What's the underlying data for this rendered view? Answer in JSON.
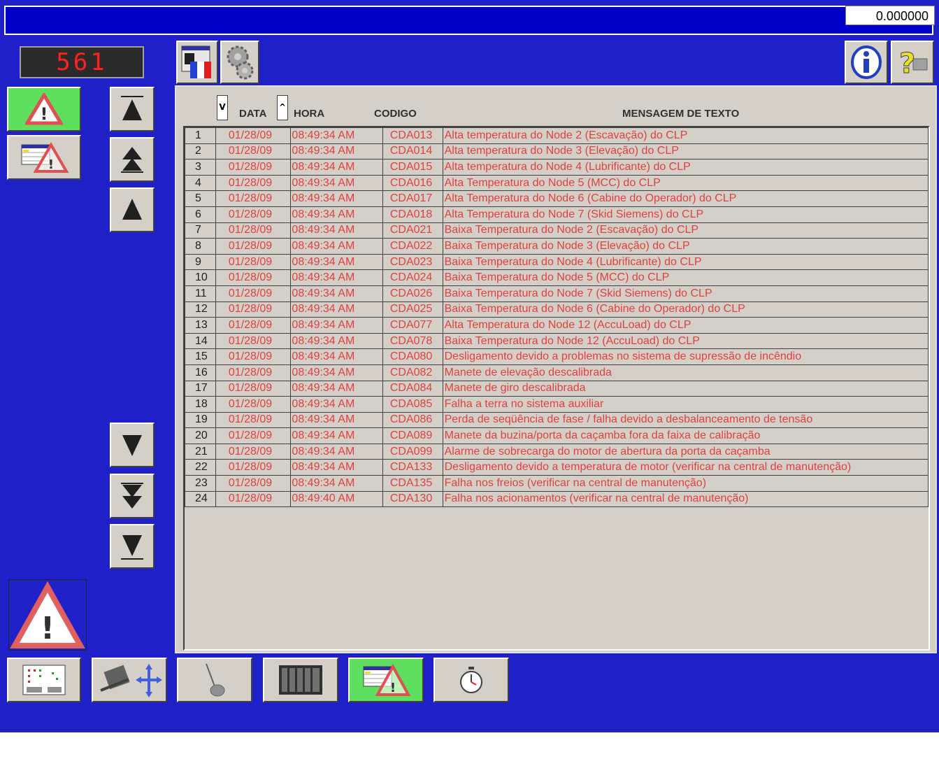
{
  "header": {
    "value_display": "0.000000"
  },
  "counter": {
    "value": "561"
  },
  "colors": {
    "background": "#2020c8",
    "accent_green": "#5ee05e",
    "alarm_text": "#e04040"
  },
  "toolbar_top": [
    {
      "icon": "language-flag-icon"
    },
    {
      "icon": "gears-icon"
    },
    {
      "icon": "info-icon"
    },
    {
      "icon": "help-icon"
    }
  ],
  "table": {
    "columns": {
      "sort_date": "V",
      "date": "DATA",
      "sort_time": "^",
      "time": "HORA",
      "code": "CODIGO",
      "message": "MENSAGEM DE TEXTO"
    },
    "rows": [
      {
        "n": "1",
        "date": "01/28/09",
        "time": "08:49:34 AM",
        "code": "CDA013",
        "msg": "Alta temperatura do Node 2 (Escavação) do CLP"
      },
      {
        "n": "2",
        "date": "01/28/09",
        "time": "08:49:34 AM",
        "code": "CDA014",
        "msg": "Alta temperatura do Node 3 (Elevação) do CLP"
      },
      {
        "n": "3",
        "date": "01/28/09",
        "time": "08:49:34 AM",
        "code": "CDA015",
        "msg": "Alta temperatura do Node 4 (Lubrificante) do CLP"
      },
      {
        "n": "4",
        "date": "01/28/09",
        "time": "08:49:34 AM",
        "code": "CDA016",
        "msg": "Alta Temperatura do Node 5 (MCC) do CLP"
      },
      {
        "n": "5",
        "date": "01/28/09",
        "time": "08:49:34 AM",
        "code": "CDA017",
        "msg": "Alta Temperatura do Node 6 (Cabine do Operador) do CLP"
      },
      {
        "n": "6",
        "date": "01/28/09",
        "time": "08:49:34 AM",
        "code": "CDA018",
        "msg": "Alta Temperatura do Node 7 (Skid Siemens) do CLP"
      },
      {
        "n": "7",
        "date": "01/28/09",
        "time": "08:49:34 AM",
        "code": "CDA021",
        "msg": "Baixa Temperatura do Node 2 (Escavação) do CLP"
      },
      {
        "n": "8",
        "date": "01/28/09",
        "time": "08:49:34 AM",
        "code": "CDA022",
        "msg": "Baixa Temperatura do Node 3 (Elevação) do CLP"
      },
      {
        "n": "9",
        "date": "01/28/09",
        "time": "08:49:34 AM",
        "code": "CDA023",
        "msg": "Baixa Temperatura do Node 4 (Lubrificante) do CLP"
      },
      {
        "n": "10",
        "date": "01/28/09",
        "time": "08:49:34 AM",
        "code": "CDA024",
        "msg": "Baixa Temperatura do Node 5 (MCC) do CLP"
      },
      {
        "n": "11",
        "date": "01/28/09",
        "time": "08:49:34 AM",
        "code": "CDA026",
        "msg": "Baixa Temperatura do Node 7 (Skid Siemens) do CLP"
      },
      {
        "n": "12",
        "date": "01/28/09",
        "time": "08:49:34 AM",
        "code": "CDA025",
        "msg": "Baixa Temperatura do Node 6 (Cabine do Operador) do CLP"
      },
      {
        "n": "13",
        "date": "01/28/09",
        "time": "08:49:34 AM",
        "code": "CDA077",
        "msg": "Alta Temperatura do Node 12 (AccuLoad) do CLP"
      },
      {
        "n": "14",
        "date": "01/28/09",
        "time": "08:49:34 AM",
        "code": "CDA078",
        "msg": "Baixa Temperatura do Node 12 (AccuLoad) do CLP"
      },
      {
        "n": "15",
        "date": "01/28/09",
        "time": "08:49:34 AM",
        "code": "CDA080",
        "msg": "Desligamento devido a problemas no sistema de supressão de incêndio"
      },
      {
        "n": "16",
        "date": "01/28/09",
        "time": "08:49:34 AM",
        "code": "CDA082",
        "msg": "Manete de elevação descalibrada"
      },
      {
        "n": "17",
        "date": "01/28/09",
        "time": "08:49:34 AM",
        "code": "CDA084",
        "msg": "Manete de giro descalibrada"
      },
      {
        "n": "18",
        "date": "01/28/09",
        "time": "08:49:34 AM",
        "code": "CDA085",
        "msg": "Falha a terra no sistema auxiliar"
      },
      {
        "n": "19",
        "date": "01/28/09",
        "time": "08:49:34 AM",
        "code": "CDA086",
        "msg": "Perda de seqüência de fase / falha devido a desbalanceamento de tensão"
      },
      {
        "n": "20",
        "date": "01/28/09",
        "time": "08:49:34 AM",
        "code": "CDA089",
        "msg": "Manete da buzina/porta da caçamba fora da faixa de calibração"
      },
      {
        "n": "21",
        "date": "01/28/09",
        "time": "08:49:34 AM",
        "code": "CDA099",
        "msg": "Alarme de sobrecarga do motor de abertura da porta da caçamba"
      },
      {
        "n": "22",
        "date": "01/28/09",
        "time": "08:49:34 AM",
        "code": "CDA133",
        "msg": "Desligamento devido a temperatura de motor (verificar na central de manutenção)"
      },
      {
        "n": "23",
        "date": "01/28/09",
        "time": "08:49:34 AM",
        "code": "CDA135",
        "msg": "Falha nos freios (verificar na central de manutenção)"
      },
      {
        "n": "24",
        "date": "01/28/09",
        "time": "08:49:40 AM",
        "code": "CDA130",
        "msg": "Falha nos acionamentos (verificar na central de manutenção)"
      }
    ]
  }
}
